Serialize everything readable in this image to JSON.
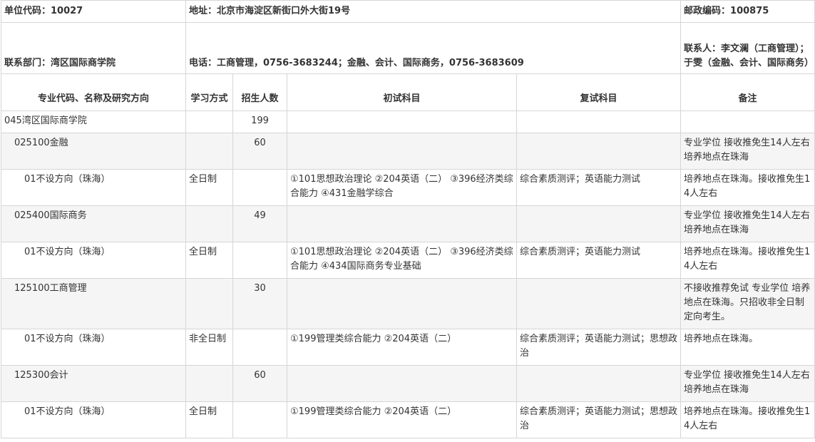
{
  "info": {
    "unit_code": "单位代码：10027",
    "address": "地址：北京市海淀区新街口外大街19号",
    "postcode": "邮政编码：100875",
    "department": "联系部门：湾区国际商学院",
    "phone": "电话：工商管理，0756-3683244；金融、会计、国际商务，0756-3683609",
    "contact": "联系人：李文澜（工商管理）；于雯（金融、会计、国际商务）"
  },
  "headers": {
    "major": "专业代码、名称及研究方向",
    "mode": "学习方式",
    "quota": "招生人数",
    "initial": "初试科目",
    "retest": "复试科目",
    "notes": "备注"
  },
  "rows": [
    {
      "name": "045湾区国际商学院",
      "mode": "",
      "quota": "199",
      "initial": "",
      "retest": "",
      "notes": ""
    },
    {
      "name": "025100金融",
      "mode": "",
      "quota": "60",
      "initial": "",
      "retest": "",
      "notes": "专业学位 接收推免生14人左右 培养地点在珠海"
    },
    {
      "name": "01不设方向（珠海）",
      "mode": "全日制",
      "quota": "",
      "initial": "①101思想政治理论 ②204英语（二） ③396经济类综合能力 ④431金融学综合",
      "retest": "综合素质测评；英语能力测试",
      "notes": "培养地点在珠海。接收推免生14人左右"
    },
    {
      "name": "025400国际商务",
      "mode": "",
      "quota": "49",
      "initial": "",
      "retest": "",
      "notes": "专业学位 接收推免生14人左右 培养地点在珠海"
    },
    {
      "name": "01不设方向（珠海）",
      "mode": "全日制",
      "quota": "",
      "initial": "①101思想政治理论 ②204英语（二） ③396经济类综合能力 ④434国际商务专业基础",
      "retest": "综合素质测评；英语能力测试",
      "notes": "培养地点在珠海。接收推免生14人左右"
    },
    {
      "name": "125100工商管理",
      "mode": "",
      "quota": "30",
      "initial": "",
      "retest": "",
      "notes": "不接收推荐免试 专业学位 培养地点在珠海。只招收非全日制定向考生。"
    },
    {
      "name": "01不设方向（珠海）",
      "mode": "非全日制",
      "quota": "",
      "initial": "①199管理类综合能力 ②204英语（二）",
      "retest": "综合素质测评；英语能力测试；思想政治",
      "notes": "培养地点在珠海。"
    },
    {
      "name": "125300会计",
      "mode": "",
      "quota": "60",
      "initial": "",
      "retest": "",
      "notes": "专业学位 接收推免生14人左右 培养地点在珠海"
    },
    {
      "name": "01不设方向（珠海）",
      "mode": "全日制",
      "quota": "",
      "initial": "①199管理类综合能力 ②204英语（二）",
      "retest": "综合素质测评；英语能力测试；思想政治",
      "notes": "培养地点在珠海。接收推免生14人左右"
    }
  ]
}
